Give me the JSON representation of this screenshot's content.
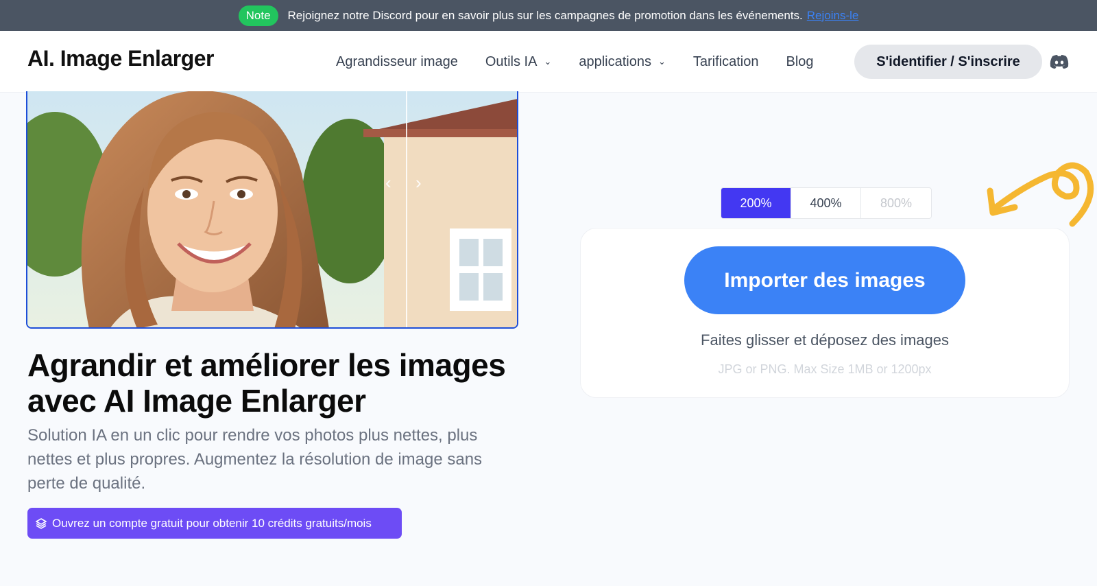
{
  "topbar": {
    "badge": "Note",
    "message": "Rejoignez notre Discord pour en savoir plus sur les campagnes de promotion dans les événements.",
    "link": "Rejoins-le"
  },
  "header": {
    "logo": "AI. Image Enlarger",
    "nav": [
      {
        "label": "Agrandisseur image"
      },
      {
        "label": "Outils IA"
      },
      {
        "label": "applications"
      },
      {
        "label": "Tarification"
      },
      {
        "label": "Blog"
      }
    ],
    "login": "S'identifier / S'inscrire",
    "discord_icon": "discord-icon"
  },
  "hero": {
    "headline": "Agrandir et améliorer les images avec AI Image Enlarger",
    "subtext": "Solution IA en un clic pour rendre vos photos plus nettes, plus nettes et plus propres. Augmentez la résolution de image sans perte de qualité.",
    "promo": "Ouvrez un compte gratuit pour obtenir 10 crédits gratuits/mois"
  },
  "upload": {
    "scales": [
      "200%",
      "400%",
      "800%"
    ],
    "selected_scale": "200%",
    "import_label": "Importer des images",
    "drag_text": "Faites glisser et déposez des images",
    "limit_text": "JPG or PNG. Max Size 1MB or 1200px"
  },
  "colors": {
    "accent": "#3b82f6",
    "active_scale": "#4338f2",
    "promo": "#6d4cf5",
    "note": "#22c55e",
    "arrow": "#f5b731"
  }
}
